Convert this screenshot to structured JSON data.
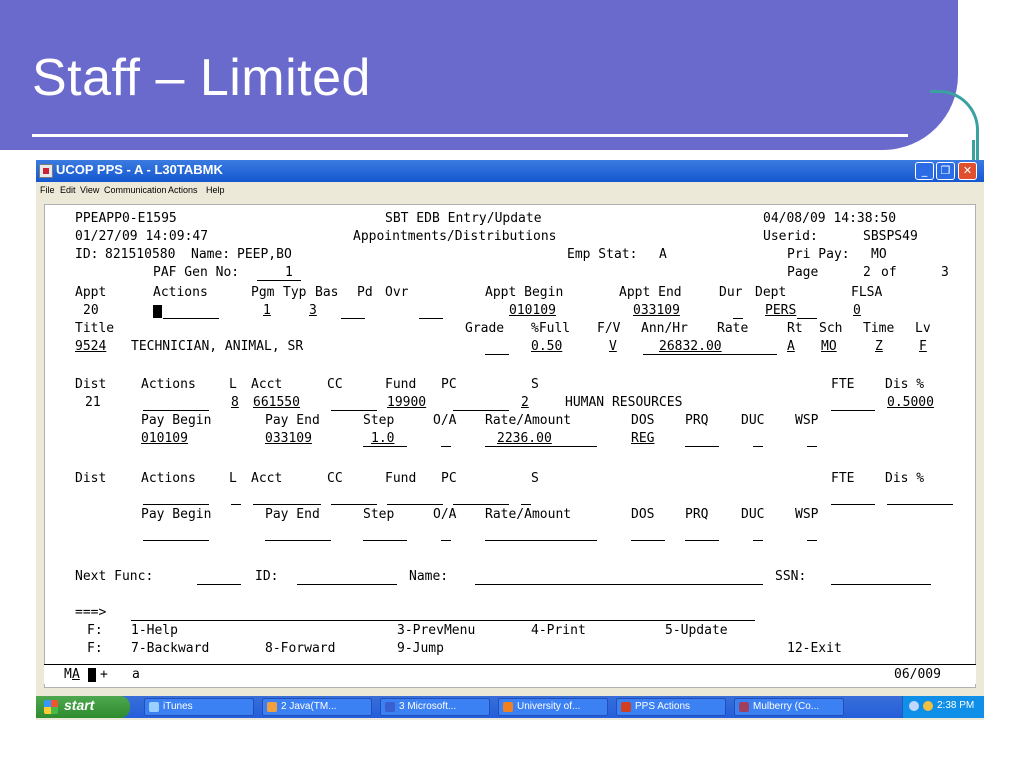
{
  "slide": {
    "title": "Staff – Limited"
  },
  "window": {
    "title": "UCOP PPS - A - L30TABMK",
    "minimize_icon": "minimize-icon",
    "maximize_icon": "maximize-icon",
    "close_icon": "close-icon",
    "minimize_glyph": "_",
    "maximize_glyph": "❐",
    "close_glyph": "✕"
  },
  "menu": [
    "File",
    "Edit",
    "View",
    "Communication",
    "Actions",
    "Help"
  ],
  "terminal": {
    "header": {
      "screen_id": "PPEAPP0-E1595",
      "system": "SBT EDB Entry/Update",
      "datetime": "04/08/09 14:38:50",
      "timestamp": "01/27/09 14:09:47",
      "screen_title": "Appointments/Distributions",
      "userid_label": "Userid:",
      "userid": "SBSPS49",
      "id_label": "ID:",
      "id": "821510580",
      "name_label": "Name:",
      "name": "PEEP,BO",
      "emp_stat_label": "Emp Stat:",
      "emp_stat": "A",
      "pri_pay_label": "Pri Pay:",
      "pri_pay": "MO",
      "paf_label": "PAF Gen No:",
      "paf_no": "1",
      "page_label": "Page",
      "page_num": "2",
      "page_of": "of",
      "page_total": "3"
    },
    "appt": {
      "header": [
        "Appt",
        "Actions",
        "Pgm",
        "Typ",
        "Bas",
        "Pd",
        "Ovr",
        "Appt Begin",
        "Appt End",
        "Dur",
        "Dept",
        "FLSA"
      ],
      "appt_no": "20",
      "pgm": "1",
      "typ": "3",
      "appt_begin": "010109",
      "appt_end": "033109",
      "dept": "PERS",
      "flsa": "0",
      "title_header": [
        "Title",
        "Grade",
        "%Full",
        "F/V",
        "Ann/Hr",
        "Rate",
        "Rt",
        "Sch",
        "Time",
        "Lv"
      ],
      "title_code": "9524",
      "title_name": "TECHNICIAN, ANIMAL, SR",
      "pct_full": "0.50",
      "fv": "V",
      "rate": "26832.00",
      "rt": "A",
      "sch": "MO",
      "time": "Z",
      "lv": "F"
    },
    "dist1": {
      "header": [
        "Dist",
        "Actions",
        "L",
        "Acct",
        "CC",
        "Fund",
        "PC",
        "S",
        "FTE",
        "Dis %"
      ],
      "dist_no": "21",
      "l": "8",
      "acct": "661550",
      "fund": "19900",
      "s": "2",
      "dept_name": "HUMAN RESOURCES",
      "dis_pct": "0.5000",
      "pay_header": [
        "Pay Begin",
        "Pay End",
        "Step",
        "O/A",
        "Rate/Amount",
        "DOS",
        "PRQ",
        "DUC",
        "WSP"
      ],
      "pay_begin": "010109",
      "pay_end": "033109",
      "step": "1.0",
      "rate_amount": "2236.00",
      "dos": "REG"
    },
    "dist2": {
      "header": [
        "Dist",
        "Actions",
        "L",
        "Acct",
        "CC",
        "Fund",
        "PC",
        "S",
        "FTE",
        "Dis %"
      ],
      "pay_header": [
        "Pay Begin",
        "Pay End",
        "Step",
        "O/A",
        "Rate/Amount",
        "DOS",
        "PRQ",
        "DUC",
        "WSP"
      ]
    },
    "next": {
      "func_label": "Next Func:",
      "id_label": "ID:",
      "name_label": "Name:",
      "ssn_label": "SSN:"
    },
    "command_prompt": "===>",
    "fkeys": {
      "f_label": "F:",
      "help": "1-Help",
      "prev": "3-PrevMenu",
      "print": "4-Print",
      "update": "5-Update",
      "backward": "7-Backward",
      "forward": "8-Forward",
      "jump": "9-Jump",
      "exit": "12-Exit"
    },
    "status": {
      "mode_prefix": "M",
      "mode_a": "A",
      "mode_plus": "+",
      "input": "a",
      "position": "06/009"
    }
  },
  "taskbar": {
    "start": "start",
    "items": [
      {
        "label": "iTunes",
        "icon": "itunes-icon",
        "color": "#9ad0ff"
      },
      {
        "label": "2 Java(TM...",
        "icon": "java-icon",
        "color": "#f0a040"
      },
      {
        "label": "3 Microsoft...",
        "icon": "word-icon",
        "color": "#3a5fd0"
      },
      {
        "label": "University of...",
        "icon": "firefox-icon",
        "color": "#f08020"
      },
      {
        "label": "PPS Actions",
        "icon": "powerpoint-icon",
        "color": "#d04020"
      },
      {
        "label": "Mulberry (Co...",
        "icon": "mulberry-icon",
        "color": "#a04060"
      }
    ],
    "time": "2:38 PM"
  },
  "colors": {
    "banner": "#6a6acc",
    "titlebar": "#1458d0",
    "taskbar": "#245edb",
    "start": "#2e8b2e"
  }
}
